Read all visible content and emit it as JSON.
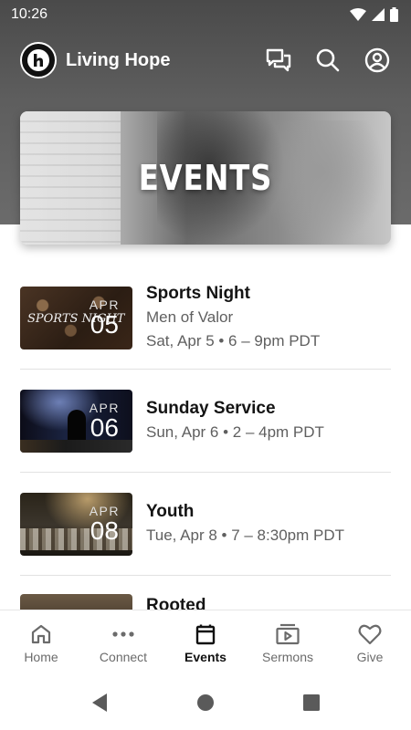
{
  "status_bar": {
    "time": "10:26"
  },
  "app_bar": {
    "title": "Living Hope",
    "icons": [
      "messages-icon",
      "search-icon",
      "account-icon"
    ]
  },
  "hero": {
    "title": "EVENTS"
  },
  "events": [
    {
      "title": "Sports Night",
      "subtitle": "Men of Valor",
      "datetime": "Sat, Apr 5 • 6 – 9pm PDT",
      "month": "APR",
      "day": "05",
      "thumb_text": "SPORTS NIGHT"
    },
    {
      "title": "Sunday Service",
      "subtitle": "",
      "datetime": "Sun, Apr 6 • 2 – 4pm PDT",
      "month": "APR",
      "day": "06"
    },
    {
      "title": "Youth",
      "subtitle": "",
      "datetime": "Tue, Apr 8 • 7 – 8:30pm PDT",
      "month": "APR",
      "day": "08"
    },
    {
      "title": "Rooted"
    }
  ],
  "bottom_nav": {
    "items": [
      {
        "label": "Home",
        "icon": "home-icon"
      },
      {
        "label": "Connect",
        "icon": "more-dots-icon"
      },
      {
        "label": "Events",
        "icon": "calendar-icon",
        "active": true
      },
      {
        "label": "Sermons",
        "icon": "play-icon"
      },
      {
        "label": "Give",
        "icon": "heart-icon"
      }
    ]
  },
  "colors": {
    "header_bg": "#5e5e5e",
    "active_nav": "#111111",
    "inactive_nav": "#6b6b6b"
  }
}
